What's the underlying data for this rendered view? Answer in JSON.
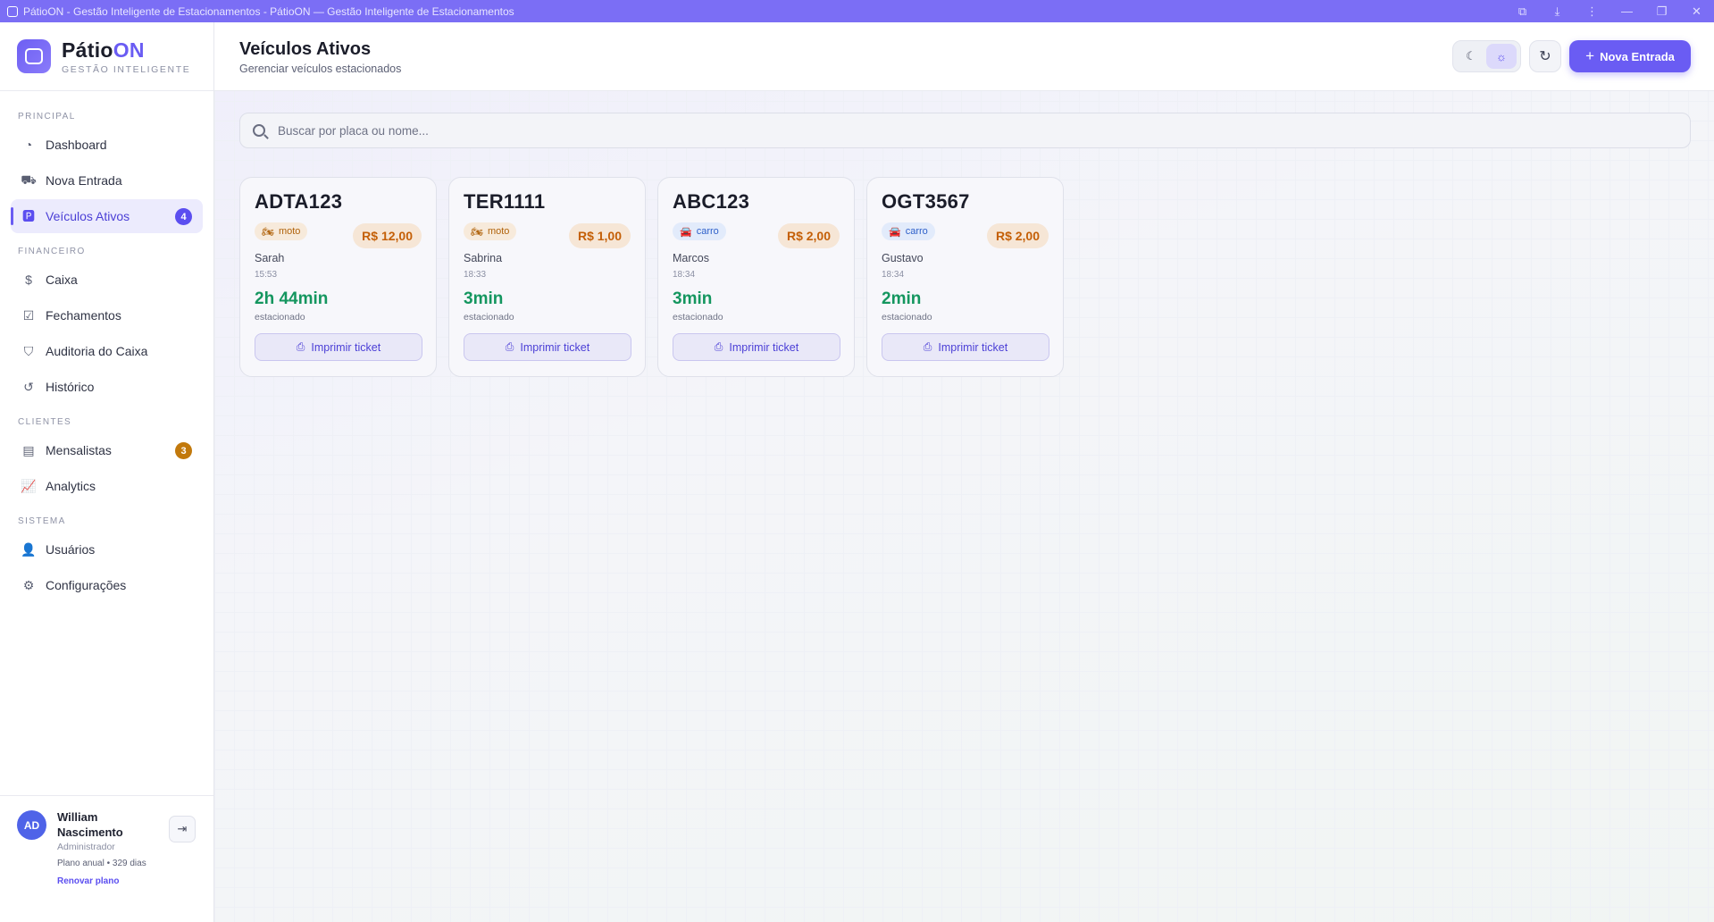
{
  "window": {
    "title": "PátioON - Gestão Inteligente de Estacionamentos - PátioON — Gestão Inteligente de Estacionamentos"
  },
  "brand": {
    "name_part1": "Pátio",
    "name_part2": "ON",
    "tagline": "GESTÃO INTELIGENTE"
  },
  "sidebar": {
    "sections": [
      {
        "label": "PRINCIPAL"
      },
      {
        "label": "FINANCEIRO"
      },
      {
        "label": "CLIENTES"
      },
      {
        "label": "SISTEMA"
      }
    ],
    "items": [
      {
        "label": "Dashboard",
        "icon": "pie-chart-icon"
      },
      {
        "label": "Nova Entrada",
        "icon": "car-icon"
      },
      {
        "label": "Veículos Ativos",
        "icon": "parking-icon",
        "badge": "4"
      },
      {
        "label": "Caixa",
        "icon": "cash-hand-icon"
      },
      {
        "label": "Fechamentos",
        "icon": "clipboard-check-icon"
      },
      {
        "label": "Auditoria do Caixa",
        "icon": "shield-icon"
      },
      {
        "label": "Histórico",
        "icon": "history-icon"
      },
      {
        "label": "Mensalistas",
        "icon": "id-card-icon",
        "badge": "3"
      },
      {
        "label": "Analytics",
        "icon": "line-chart-icon"
      },
      {
        "label": "Usuários",
        "icon": "user-cog-icon"
      },
      {
        "label": "Configurações",
        "icon": "gears-icon"
      }
    ]
  },
  "user": {
    "initials": "AD",
    "name": "William Nascimento",
    "role": "Administrador",
    "plan": "Plano anual • 329 dias",
    "renew": "Renovar plano"
  },
  "header": {
    "title": "Veículos Ativos",
    "subtitle": "Gerenciar veículos estacionados",
    "new_entry_label": "Nova Entrada"
  },
  "search": {
    "placeholder": "Buscar por placa ou nome..."
  },
  "vehicles": [
    {
      "plate": "ADTA123",
      "type": "moto",
      "price": "R$ 12,00",
      "name": "Sarah",
      "time": "15:53",
      "duration": "2h 44min",
      "duration_label": "estacionado",
      "print_label": "Imprimir ticket"
    },
    {
      "plate": "TER1111",
      "type": "moto",
      "price": "R$ 1,00",
      "name": "Sabrina",
      "time": "18:33",
      "duration": "3min",
      "duration_label": "estacionado",
      "print_label": "Imprimir ticket"
    },
    {
      "plate": "ABC123",
      "type": "carro",
      "price": "R$ 2,00",
      "name": "Marcos",
      "time": "18:34",
      "duration": "3min",
      "duration_label": "estacionado",
      "print_label": "Imprimir ticket"
    },
    {
      "plate": "OGT3567",
      "type": "carro",
      "price": "R$ 2,00",
      "name": "Gustavo",
      "time": "18:34",
      "duration": "2min",
      "duration_label": "estacionado",
      "print_label": "Imprimir ticket"
    }
  ],
  "colors": {
    "accent": "#6a5cf3",
    "titlebar": "#7b6ef5",
    "duration_green": "#14965f",
    "price_orange": "#c45f07"
  }
}
